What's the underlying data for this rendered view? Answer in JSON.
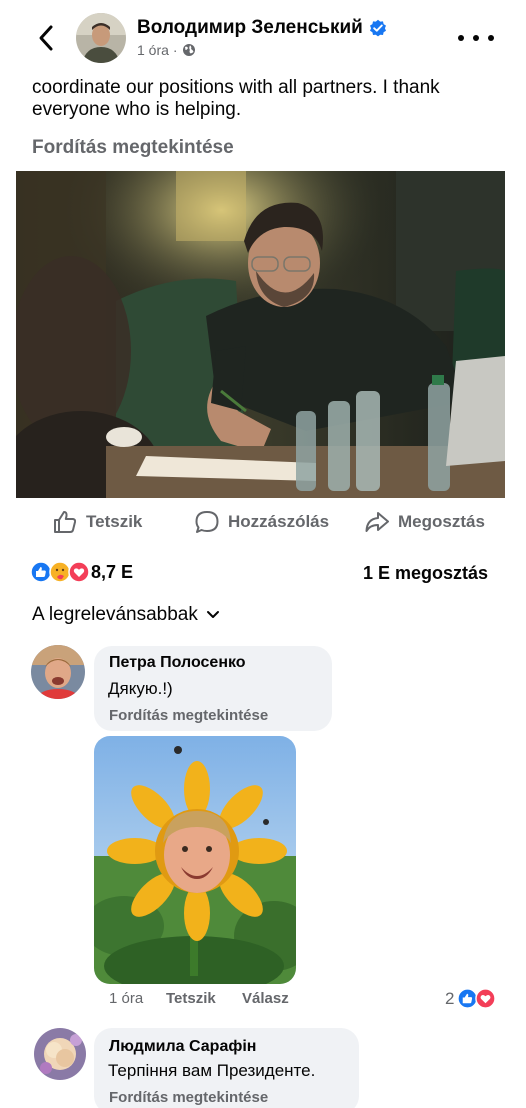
{
  "header": {
    "author": "Володимир Зеленський",
    "time": "1 óra",
    "separator": "·",
    "back_icon": "chevron-left-icon",
    "more_icon": "more-horizontal-icon"
  },
  "post": {
    "text": "coordinate our positions with all partners. I thank everyone who is helping.",
    "translate": "Fordítás megtekintése"
  },
  "actions": {
    "like": "Tetszik",
    "comment": "Hozzászólás",
    "share": "Megosztás"
  },
  "summary": {
    "reactions_count": "8,7 E",
    "shares": "1 E megosztás"
  },
  "sort": {
    "label": "A legrelevánsabbak"
  },
  "comments": [
    {
      "author": "Петра Полосенко",
      "text": "Дякую.!)",
      "translate": "Fordítás megtekintése",
      "time": "1 óra",
      "like": "Tetszik",
      "reply": "Válasz",
      "reaction_count": "2"
    },
    {
      "author": "Людмила Сарафін",
      "text": "Терпіння вам Президенте.",
      "translate": "Fordítás megtekintése"
    }
  ],
  "colors": {
    "blue": "#1877f2",
    "red": "#f33e58",
    "secondary_text": "#65676b",
    "bubble": "#f0f2f5"
  }
}
